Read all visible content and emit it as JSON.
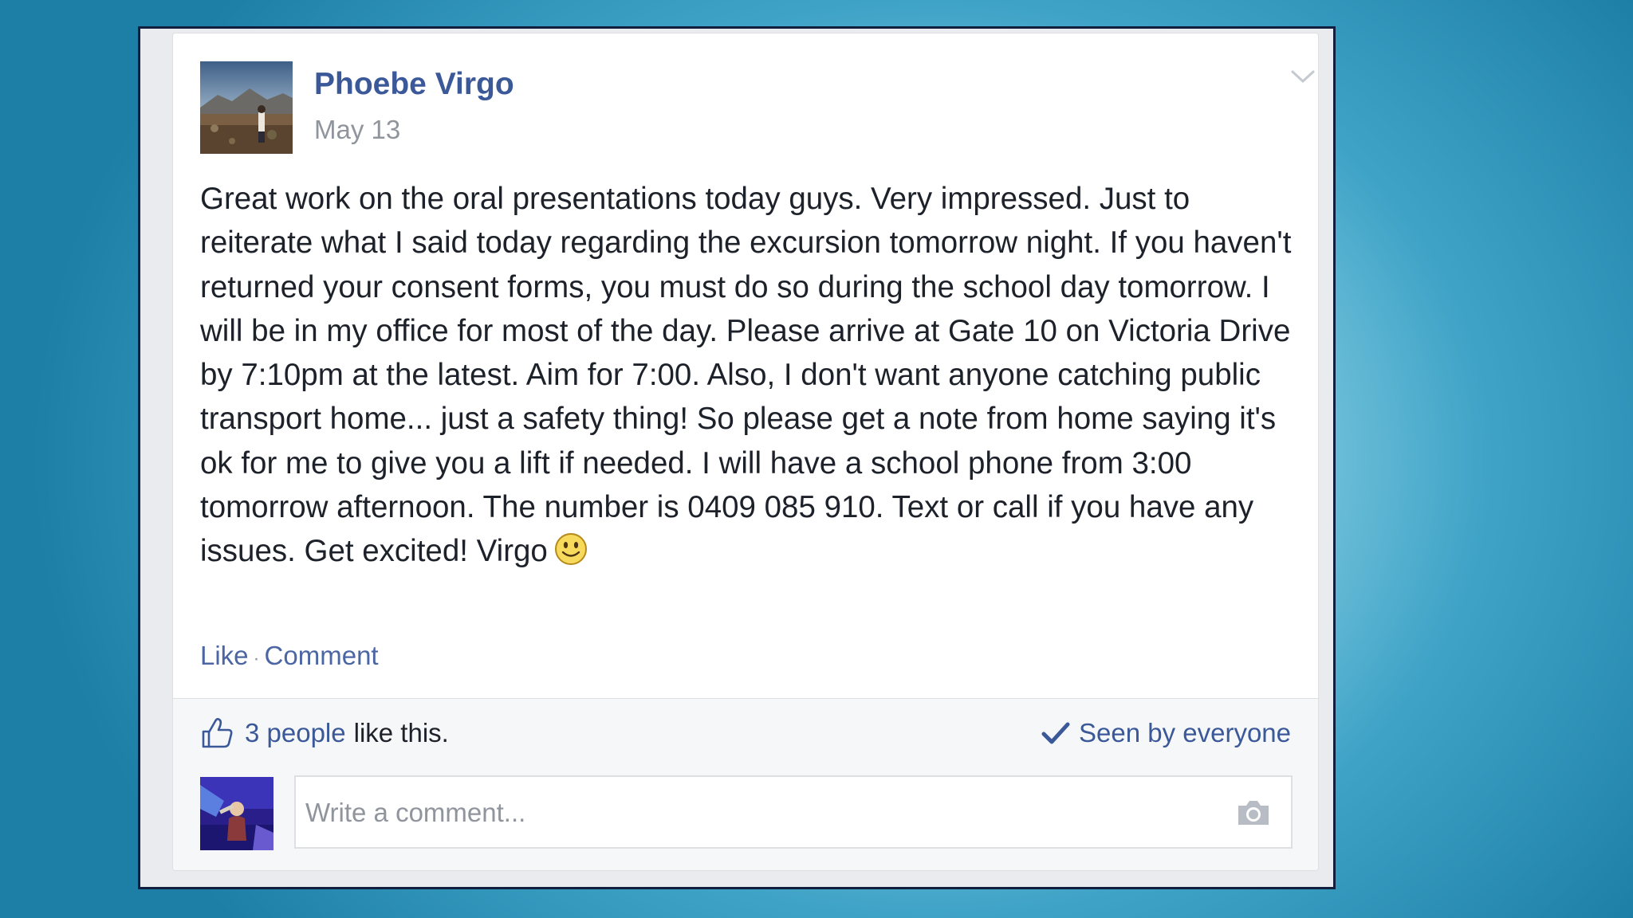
{
  "post": {
    "author": "Phoebe Virgo",
    "date": "May 13",
    "body": "Great work on the oral presentations today guys. Very impressed. Just to reiterate what I said today regarding the excursion tomorrow night. If you haven't returned your consent forms, you must do so during the school day tomorrow. I will be in my office for most of the day. Please arrive at Gate 10 on Victoria Drive by 7:10pm at the latest. Aim for 7:00. Also, I don't want anyone catching public transport home... just a safety thing! So please get a note from home saying it's ok for me to give you a lift if needed. I will have a school phone from 3:00 tomorrow afternoon. The number is 0409 085 910. Text or call if you have any issues. Get excited! Virgo",
    "emoji": "smiley-face-icon"
  },
  "actions": {
    "like_label": "Like",
    "separator": "·",
    "comment_label": "Comment"
  },
  "likes": {
    "count_text": "3 people",
    "rest_text": "like this."
  },
  "audience": {
    "label": "Seen by everyone"
  },
  "comment": {
    "placeholder": "Write a comment..."
  },
  "icons": {
    "options": "chevron-down-icon",
    "like": "thumbs-up-icon",
    "seen": "checkmark-icon",
    "attach_photo": "camera-icon"
  },
  "colors": {
    "link_blue": "#3b5998",
    "text": "#1d2129",
    "muted": "#90949c",
    "frame": "#0f1f3d",
    "background": "#3fa3c7"
  }
}
